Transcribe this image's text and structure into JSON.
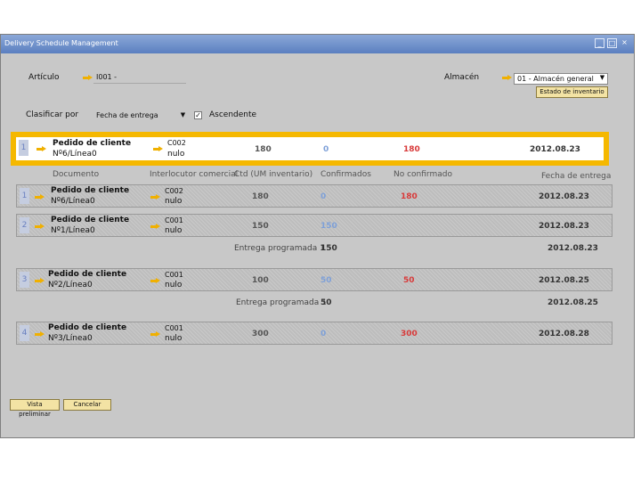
{
  "window": {
    "title": "Delivery Schedule Management"
  },
  "articulo": {
    "label": "Artículo",
    "value": "I001 -"
  },
  "almacen": {
    "label": "Almacén",
    "value": "01 - Almacén general",
    "button": "Estado de inventario"
  },
  "sort": {
    "label": "Clasificar por",
    "value": "Fecha de entrega",
    "ascending_label": "Ascendente",
    "ascending_checked": true
  },
  "top_row": {
    "num": "1",
    "doc1": "Pedido de cliente",
    "doc2": "Nº6/Línea0",
    "bp1": "C002",
    "bp2": "nulo",
    "qty": "180",
    "conf": "0",
    "noconf": "180",
    "date": "2012.08.23"
  },
  "columns": {
    "doc": "Documento",
    "bp": "Interlocutor comercial",
    "qty": "Ctd (UM inventario)",
    "conf": "Confirmados",
    "noconf": "No confirmado",
    "date": "Fecha de entrega"
  },
  "rows": [
    {
      "num": "1",
      "doc1": "Pedido de cliente",
      "doc2": "Nº6/Línea0",
      "bp1": "C002",
      "bp2": "nulo",
      "qty": "180",
      "conf": "0",
      "noconf": "180",
      "date": "2012.08.23"
    },
    {
      "num": "2",
      "doc1": "Pedido de cliente",
      "doc2": "Nº1/Línea0",
      "bp1": "C001",
      "bp2": "nulo",
      "qty": "150",
      "conf": "150",
      "noconf": "",
      "date": "2012.08.23"
    },
    {
      "num": "3",
      "doc1": "Pedido de cliente",
      "doc2": "Nº2/Línea0",
      "bp1": "C001",
      "bp2": "nulo",
      "qty": "100",
      "conf": "50",
      "noconf": "50",
      "date": "2012.08.25"
    },
    {
      "num": "4",
      "doc1": "Pedido de cliente",
      "doc2": "Nº3/Línea0",
      "bp1": "C001",
      "bp2": "nulo",
      "qty": "300",
      "conf": "0",
      "noconf": "300",
      "date": "2012.08.28"
    }
  ],
  "schedules": [
    {
      "label": "Entrega programada 1",
      "qty": "150",
      "date": "2012.08.23"
    },
    {
      "label": "Entrega programada 1",
      "qty": "50",
      "date": "2012.08.25"
    }
  ],
  "buttons": {
    "preview": "Vista preliminar",
    "cancel": "Cancelar"
  }
}
